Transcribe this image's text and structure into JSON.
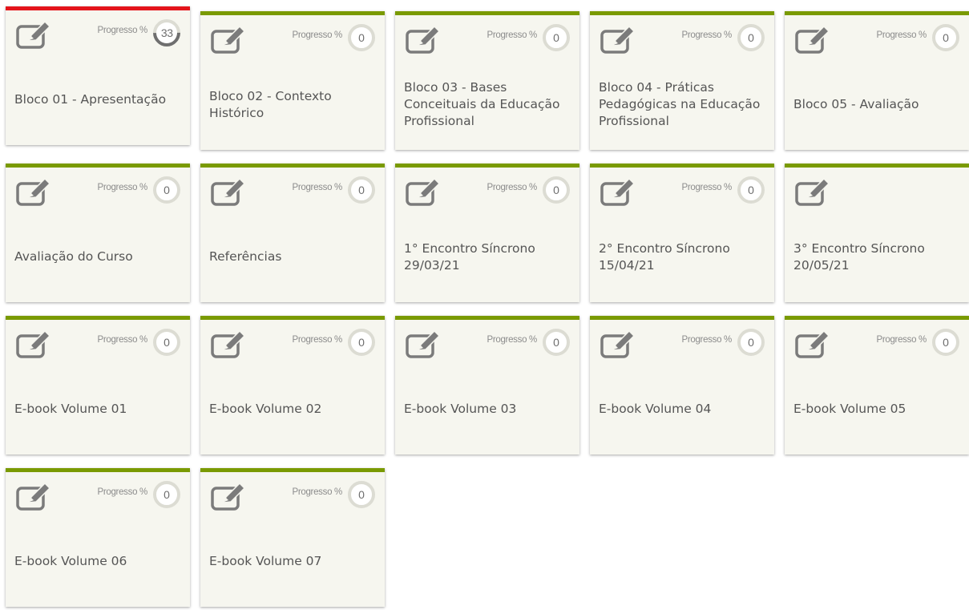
{
  "progress_label": "Progresso %",
  "colors": {
    "accent_bar": "#7a9a01",
    "active_bar": "#e4141b",
    "tile_bg": "#f6f6ef"
  },
  "icon": "edit-pencil-icon",
  "tiles": [
    {
      "title": "Bloco 01 - Apresentação",
      "progress": "33",
      "progress_value": 33,
      "active": true
    },
    {
      "title": "Bloco 02 - Contexto Histórico",
      "progress": "0",
      "progress_value": 0
    },
    {
      "title": "Bloco 03 - Bases Conceituais da Educação Profissional",
      "progress": "0",
      "progress_value": 0
    },
    {
      "title": "Bloco 04 - Práticas Pedagógicas na Educação Profissional",
      "progress": "0",
      "progress_value": 0
    },
    {
      "title": "Bloco 05 - Avaliação",
      "progress": "0",
      "progress_value": 0
    },
    {
      "title": "Avaliação do Curso",
      "progress": "0",
      "progress_value": 0
    },
    {
      "title": "Referências",
      "progress": "0",
      "progress_value": 0
    },
    {
      "title": "1° Encontro Síncrono 29/03/21",
      "progress": "0",
      "progress_value": 0
    },
    {
      "title": "2° Encontro Síncrono 15/04/21",
      "progress": "0",
      "progress_value": 0
    },
    {
      "title": "3° Encontro Síncrono 20/05/21",
      "progress": null,
      "progress_value": null
    },
    {
      "title": "E-book Volume 01",
      "progress": "0",
      "progress_value": 0
    },
    {
      "title": "E-book Volume 02",
      "progress": "0",
      "progress_value": 0
    },
    {
      "title": "E-book Volume 03",
      "progress": "0",
      "progress_value": 0
    },
    {
      "title": "E-book Volume 04",
      "progress": "0",
      "progress_value": 0
    },
    {
      "title": "E-book Volume 05",
      "progress": "0",
      "progress_value": 0
    },
    {
      "title": "E-book Volume 06",
      "progress": "0",
      "progress_value": 0
    },
    {
      "title": "E-book Volume 07",
      "progress": "0",
      "progress_value": 0
    }
  ]
}
